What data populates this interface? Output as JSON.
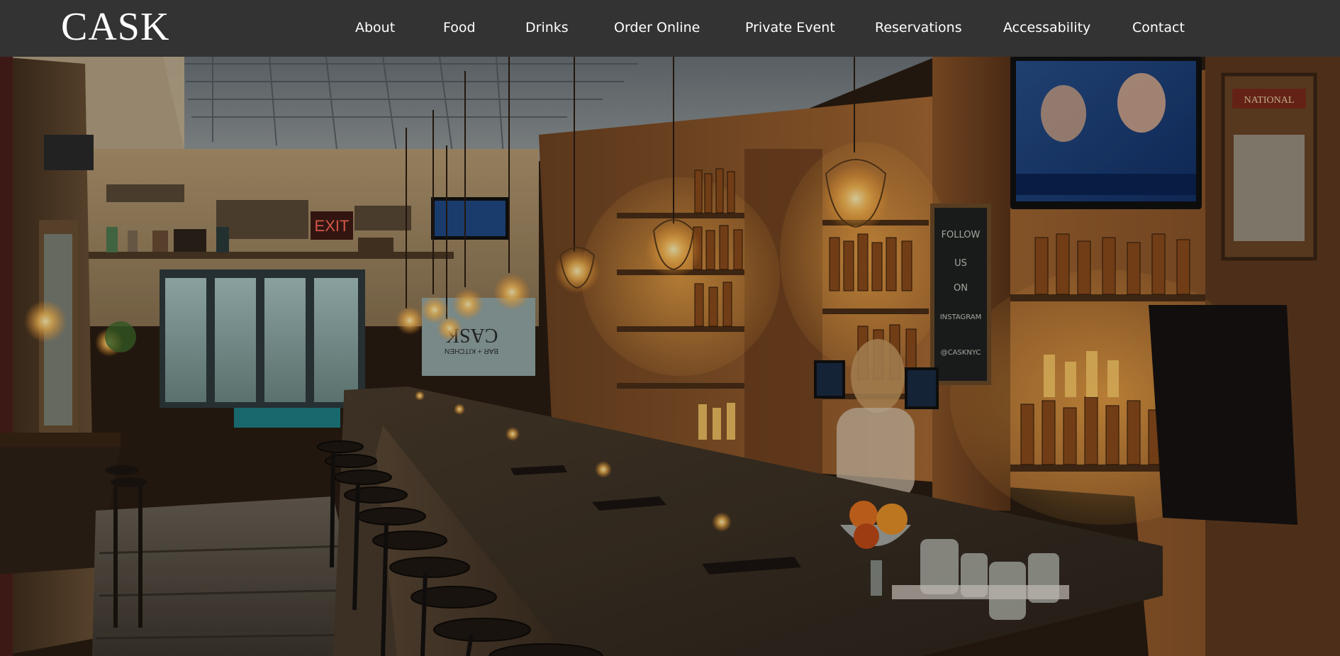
{
  "brand": {
    "logo_text": "CASK"
  },
  "nav": {
    "items": [
      {
        "label": "About"
      },
      {
        "label": "Food"
      },
      {
        "label": "Drinks"
      },
      {
        "label": "Order Online"
      },
      {
        "label": "Private Event"
      },
      {
        "label": "Reservations"
      },
      {
        "label": "Accessability"
      },
      {
        "label": "Contact"
      }
    ]
  },
  "hero": {
    "exit_sign": "EXIT",
    "chalkboard_text": [
      "FOLLOW",
      "US",
      "ON",
      "INSTAGRAM",
      "@CASKNYC"
    ],
    "window_lettering": "CASK",
    "window_sublettering": "BAR + KITCHEN",
    "sign_text": "NATIONAL"
  },
  "colors": {
    "navbar_bg": "#333333",
    "nav_text": "#ffffff",
    "wood_warm": "#8a5a2b",
    "bar_top": "#3a3128",
    "light_glow": "#ffd27a"
  }
}
